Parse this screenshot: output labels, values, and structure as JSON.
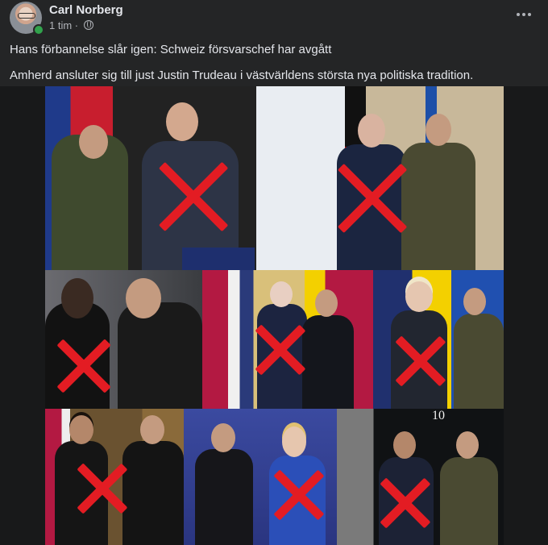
{
  "post": {
    "author": "Carl Norberg",
    "time": "1 tim",
    "separator": "·",
    "text_line1": "Hans förbannelse slår igen: Schweiz försvarschef har avgått",
    "text_line2": "Amherd ansluter sig till just Justin Trudeau i västvärldens största nya politiska tradition."
  },
  "icons": {
    "audience": "globe-icon",
    "more": "more-options-icon",
    "online": "online-status-icon"
  },
  "image": {
    "door_number": "10"
  },
  "colors": {
    "background": "#242526",
    "text": "#e4e6eb",
    "secondary_text": "#b0b3b8",
    "cross": "#e31c23",
    "online": "#31a24c"
  }
}
